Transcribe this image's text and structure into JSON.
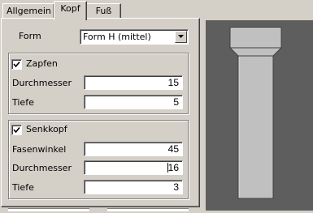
{
  "tabs": [
    {
      "label": "Allgemein",
      "active": false
    },
    {
      "label": "Kopf",
      "active": true
    },
    {
      "label": "Fuß",
      "active": false
    }
  ],
  "form": {
    "label": "Form",
    "value": "Form H (mittel)",
    "icon": "chevron-down-icon"
  },
  "zapfen": {
    "title": "Zapfen",
    "checked": true,
    "durchmesser_label": "Durchmesser",
    "durchmesser_value": "15",
    "tiefe_label": "Tiefe",
    "tiefe_value": "5"
  },
  "senkkopf": {
    "title": "Senkkopf",
    "checked": true,
    "fasenwinkel_label": "Fasenwinkel",
    "fasenwinkel_value": "45",
    "durchmesser_label": "Durchmesser",
    "durchmesser_value": "16",
    "tiefe_label": "Tiefe",
    "tiefe_value": "3"
  },
  "colors": {
    "preview_background": "#5e5e5e",
    "bolt_fill": "#c0c0c0",
    "window_face": "#d4d0c8"
  }
}
